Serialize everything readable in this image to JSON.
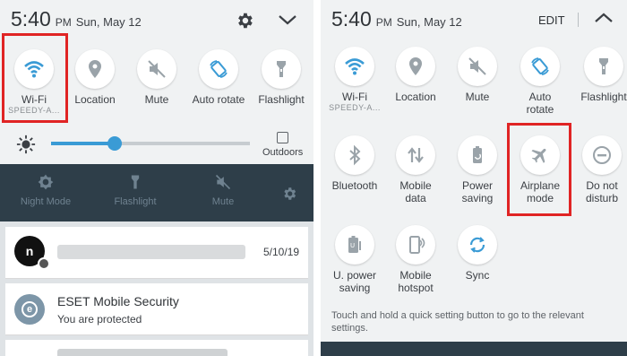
{
  "left": {
    "status": {
      "time": "5:40",
      "ampm": "PM",
      "date": "Sun, May 12"
    },
    "tiles": [
      {
        "label": "Wi-Fi",
        "sublabel": "SPEEDY-A...",
        "icon": "wifi-icon"
      },
      {
        "label": "Location",
        "icon": "location-pin-icon"
      },
      {
        "label": "Mute",
        "icon": "mute-icon"
      },
      {
        "label": "Auto rotate",
        "icon": "auto-rotate-icon"
      },
      {
        "label": "Flashlight",
        "icon": "flashlight-icon"
      }
    ],
    "brightness": {
      "level": 0.32,
      "outdoors_label": "Outdoors",
      "outdoors_checked": false
    },
    "dark_bar": {
      "items": [
        {
          "label": "Night Mode",
          "icon": "night-mode-icon"
        },
        {
          "label": "Flashlight",
          "icon": "flashlight-icon"
        },
        {
          "label": "Mute",
          "icon": "mute-icon"
        }
      ]
    },
    "notifications": [
      {
        "avatar_letter": "n",
        "title": "",
        "date": "5/10/19"
      },
      {
        "app_letter": "e",
        "title": "ESET Mobile Security",
        "text": "You are protected"
      }
    ]
  },
  "right": {
    "status": {
      "time": "5:40",
      "ampm": "PM",
      "date": "Sun, May 12",
      "edit_label": "EDIT"
    },
    "tiles": [
      {
        "label": "Wi-Fi",
        "sublabel": "SPEEDY-A...",
        "icon": "wifi-icon"
      },
      {
        "label": "Location",
        "icon": "location-pin-icon"
      },
      {
        "label": "Mute",
        "icon": "mute-icon"
      },
      {
        "label": "Auto",
        "label2": "rotate",
        "icon": "auto-rotate-icon"
      },
      {
        "label": "Flashlight",
        "icon": "flashlight-icon"
      },
      {
        "label": "Bluetooth",
        "icon": "bluetooth-icon"
      },
      {
        "label": "Mobile",
        "label2": "data",
        "icon": "mobile-data-icon"
      },
      {
        "label": "Power",
        "label2": "saving",
        "icon": "power-saving-icon"
      },
      {
        "label": "Airplane",
        "label2": "mode",
        "icon": "airplane-icon"
      },
      {
        "label": "Do not",
        "label2": "disturb",
        "icon": "do-not-disturb-icon"
      },
      {
        "label": "U. power",
        "label2": "saving",
        "icon": "ultra-power-saving-icon"
      },
      {
        "label": "Mobile",
        "label2": "hotspot",
        "icon": "hotspot-icon"
      },
      {
        "label": "Sync",
        "icon": "sync-icon"
      }
    ],
    "hint": "Touch and hold a quick setting button to go to the relevant settings."
  },
  "colors": {
    "highlight": "#e02424",
    "icon_blue": "#3a9bd5",
    "icon_gray": "#9aa3a9",
    "dark_bar": "#2e3e49"
  }
}
